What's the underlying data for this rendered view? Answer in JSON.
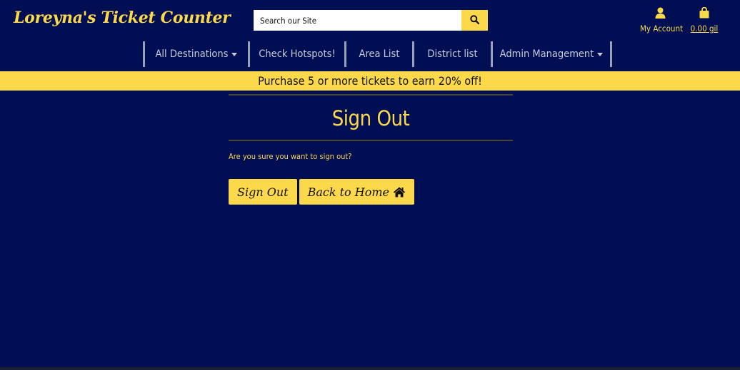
{
  "header": {
    "logo": "Loreyna's Ticket Counter",
    "search_placeholder": "Search our Site",
    "account_label": "My Account",
    "cart_label": "0.00 gil"
  },
  "nav": {
    "items": [
      {
        "label": "All Destinations",
        "dropdown": true
      },
      {
        "label": "Check Hotspots!",
        "dropdown": false
      },
      {
        "label": "Area List",
        "dropdown": false
      },
      {
        "label": "District list",
        "dropdown": false
      },
      {
        "label": "Admin Management",
        "dropdown": true
      }
    ]
  },
  "promo": "Purchase 5 or more tickets to earn 20% off!",
  "main": {
    "title": "Sign Out",
    "question": "Are you sure you want to sign out?",
    "sign_out_label": "Sign Out",
    "back_home_label": "Back to Home"
  },
  "icons": {
    "search": "search-icon",
    "account": "user-icon",
    "cart": "shopping-bag-icon",
    "home": "home-icon"
  },
  "colors": {
    "background": "#000e54",
    "accent": "#fcd94b",
    "nav_text": "#c8cbd6"
  }
}
